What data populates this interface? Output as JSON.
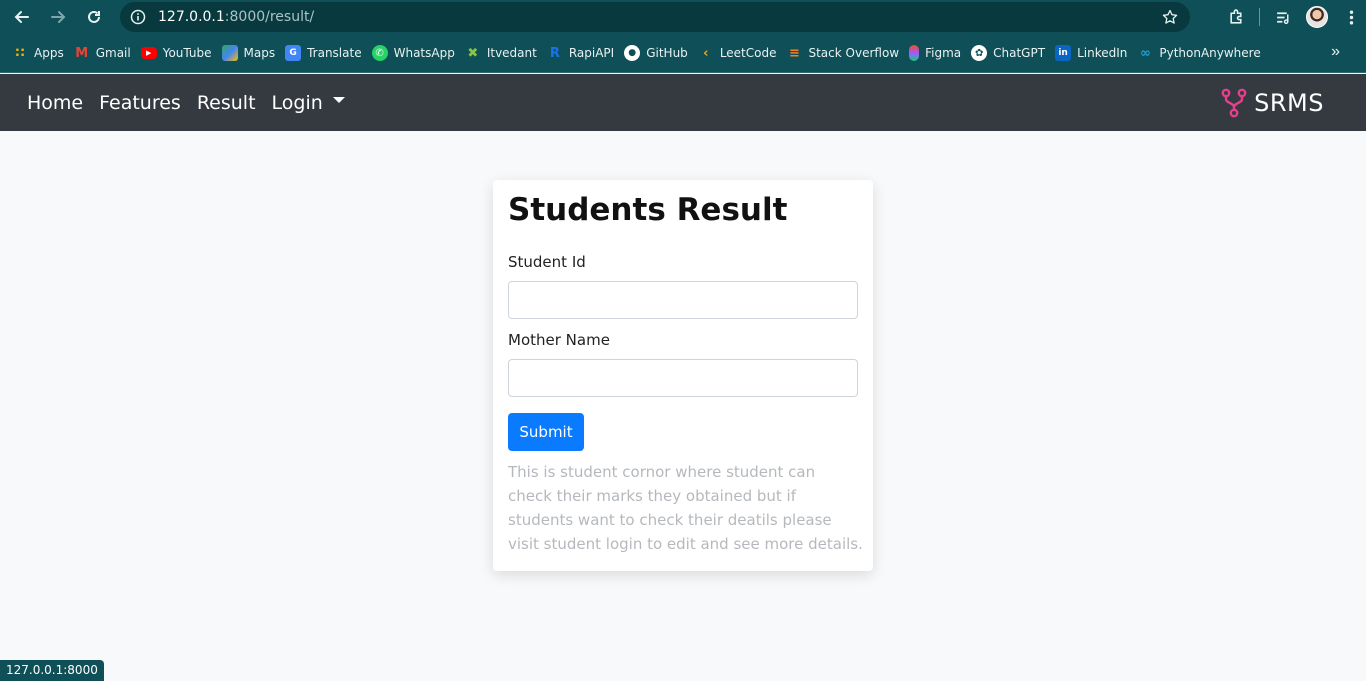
{
  "browser": {
    "url_host": "127.0.0.1",
    "url_rest": ":8000/result/",
    "status_text": "127.0.0.1:8000"
  },
  "bookmarks": [
    {
      "label": "Apps",
      "icon": "apps-grid-icon",
      "color": "#f4b400"
    },
    {
      "label": "Gmail",
      "icon": "gmail-icon",
      "color": "#ea4335"
    },
    {
      "label": "YouTube",
      "icon": "youtube-icon",
      "color": "#ff0000"
    },
    {
      "label": "Maps",
      "icon": "maps-icon",
      "color": "#34a853"
    },
    {
      "label": "Translate",
      "icon": "translate-icon",
      "color": "#4285f4"
    },
    {
      "label": "WhatsApp",
      "icon": "whatsapp-icon",
      "color": "#25d366"
    },
    {
      "label": "Itvedant",
      "icon": "itvedant-icon",
      "color": "#8bc34a"
    },
    {
      "label": "RapiAPI",
      "icon": "rapidapi-icon",
      "color": "#1a73e8"
    },
    {
      "label": "GitHub",
      "icon": "github-icon",
      "color": "#ffffff"
    },
    {
      "label": "LeetCode",
      "icon": "leetcode-icon",
      "color": "#ffa116"
    },
    {
      "label": "Stack Overflow",
      "icon": "stackoverflow-icon",
      "color": "#f48024"
    },
    {
      "label": "Figma",
      "icon": "figma-icon",
      "color": "#a259ff"
    },
    {
      "label": "ChatGPT",
      "icon": "chatgpt-icon",
      "color": "#ffffff"
    },
    {
      "label": "LinkedIn",
      "icon": "linkedin-icon",
      "color": "#0a66c2"
    },
    {
      "label": "PythonAnywhere",
      "icon": "pythonanywhere-icon",
      "color": "#1d9fd8"
    }
  ],
  "navbar": {
    "links": [
      "Home",
      "Features",
      "Result",
      "Login"
    ],
    "brand": "SRMS",
    "brand_color": "#e83e8c"
  },
  "card": {
    "title": "Students Result",
    "student_id_label": "Student Id",
    "mother_name_label": "Mother Name",
    "submit_label": "Submit",
    "note": "This is student cornor where student can check their marks they obtained but if students want to check their deatils please visit student login to edit and see more details."
  },
  "colors": {
    "browser_bg": "#0f4f57",
    "navbar_bg": "#343a40",
    "primary": "#0a7bff"
  }
}
